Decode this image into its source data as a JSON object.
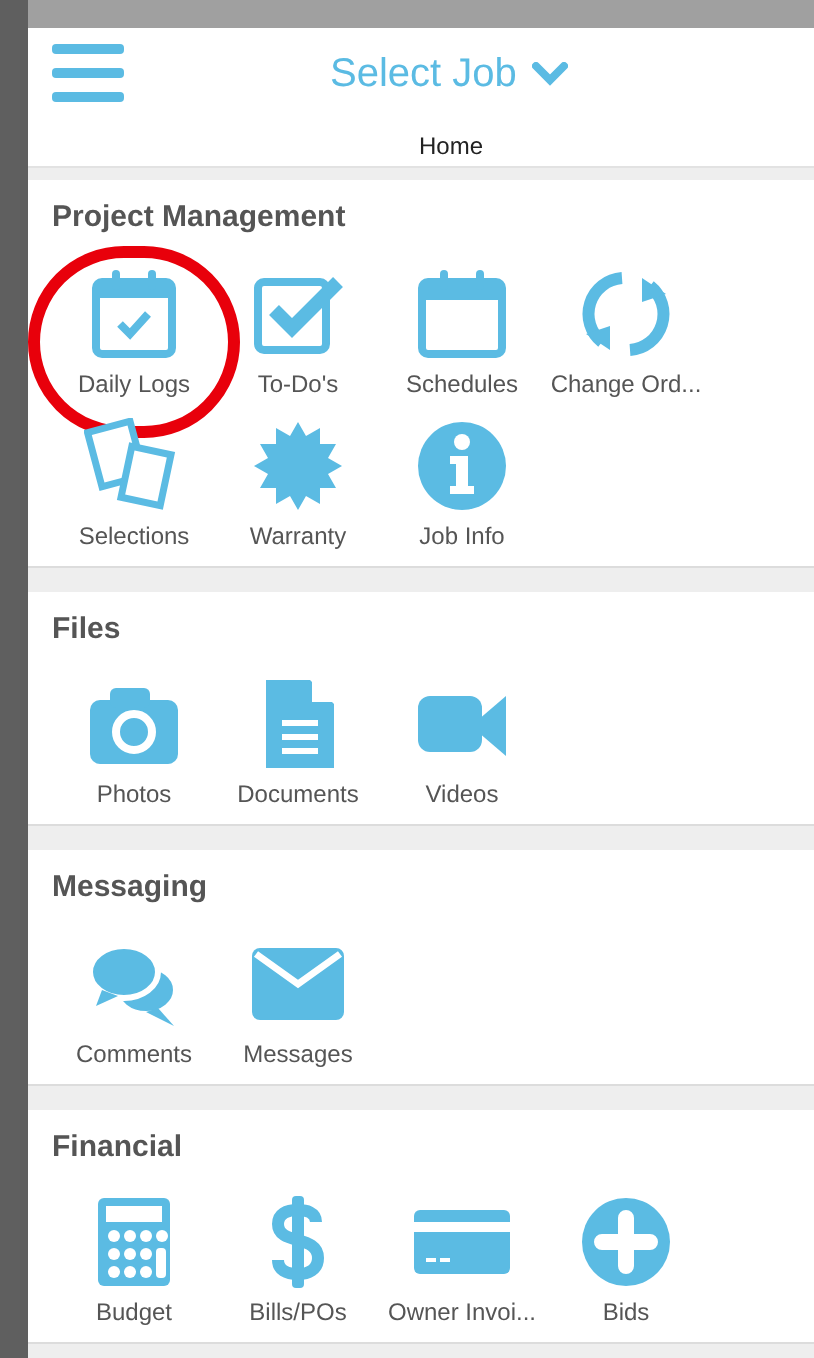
{
  "header": {
    "title": "Select Job",
    "subtitle": "Home"
  },
  "sections": [
    {
      "title": "Project Management",
      "items": [
        {
          "label": "Daily Logs",
          "kind": "calendar-check",
          "circled": true
        },
        {
          "label": "To-Do's",
          "kind": "checkbox",
          "circled": false
        },
        {
          "label": "Schedules",
          "kind": "calendar",
          "circled": false
        },
        {
          "label": "Change Ord...",
          "kind": "sync",
          "circled": false
        },
        {
          "label": "Selections",
          "kind": "papers",
          "circled": false
        },
        {
          "label": "Warranty",
          "kind": "seal",
          "circled": false
        },
        {
          "label": "Job Info",
          "kind": "info",
          "circled": false
        }
      ]
    },
    {
      "title": "Files",
      "items": [
        {
          "label": "Photos",
          "kind": "camera",
          "circled": false
        },
        {
          "label": "Documents",
          "kind": "document",
          "circled": false
        },
        {
          "label": "Videos",
          "kind": "video",
          "circled": false
        }
      ]
    },
    {
      "title": "Messaging",
      "items": [
        {
          "label": "Comments",
          "kind": "comments",
          "circled": false
        },
        {
          "label": "Messages",
          "kind": "envelope",
          "circled": false
        }
      ]
    },
    {
      "title": "Financial",
      "items": [
        {
          "label": "Budget",
          "kind": "calculator",
          "circled": false
        },
        {
          "label": "Bills/POs",
          "kind": "dollar",
          "circled": false
        },
        {
          "label": "Owner Invoi...",
          "kind": "card",
          "circled": false
        },
        {
          "label": "Bids",
          "kind": "plus",
          "circled": false
        }
      ]
    }
  ]
}
